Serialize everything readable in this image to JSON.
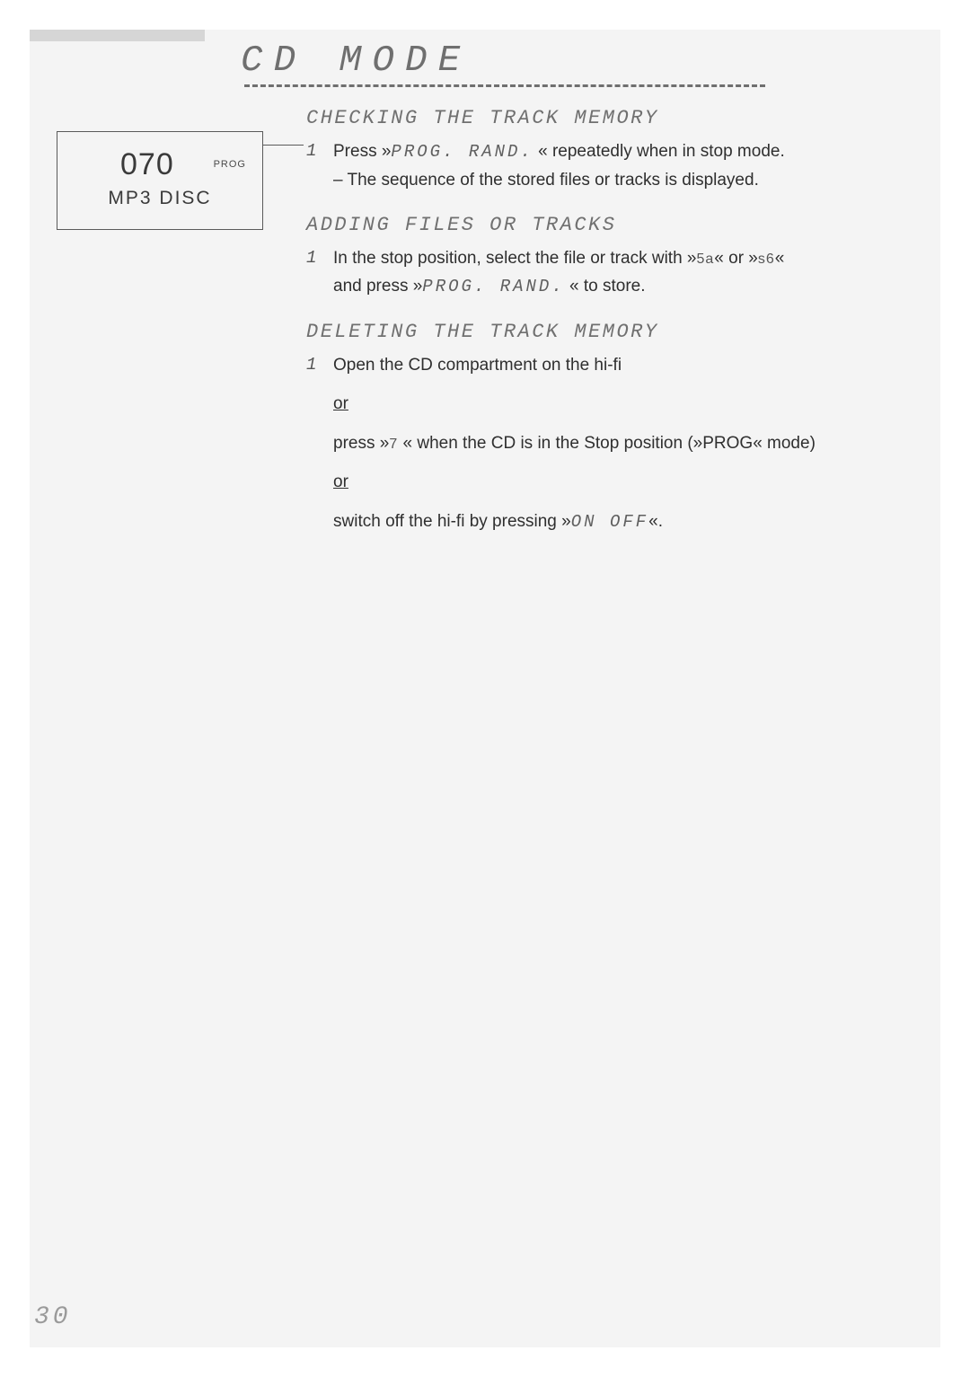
{
  "heading": "CD MODE",
  "display": {
    "number": "070",
    "prog": "PROG",
    "sub": "MP3 DISC"
  },
  "sections": {
    "check": {
      "title": "CHECKING THE TRACK MEMORY",
      "step_num": "1",
      "l1a": "Press »",
      "l1_btn": "PROG. RAND.",
      "l1b": "« repeatedly when in stop mode.",
      "l2": "– The sequence of the stored files or tracks is displayed."
    },
    "add": {
      "title": "ADDING FILES OR TRACKS",
      "step_num": "1",
      "l1a": "In the stop position, select the file or track with »",
      "k1": "5a",
      "mid": "« or »",
      "k2": "s6",
      "l1e": "«",
      "l2a": "and press »",
      "l2_btn": "PROG. RAND.",
      "l2b": "« to store."
    },
    "del": {
      "title": "DELETING THE TRACK MEMORY",
      "step_num": "1",
      "l1": "Open the CD compartment on the hi-fi",
      "or": "or",
      "l2a": "press »",
      "k7": "7",
      "l2b": "« when the CD is in the Stop position (»PROG« mode)",
      "l3a": "switch off the hi-fi by pressing »",
      "onoff": "ON OFF",
      "l3b": "«."
    }
  },
  "page_number": "30"
}
